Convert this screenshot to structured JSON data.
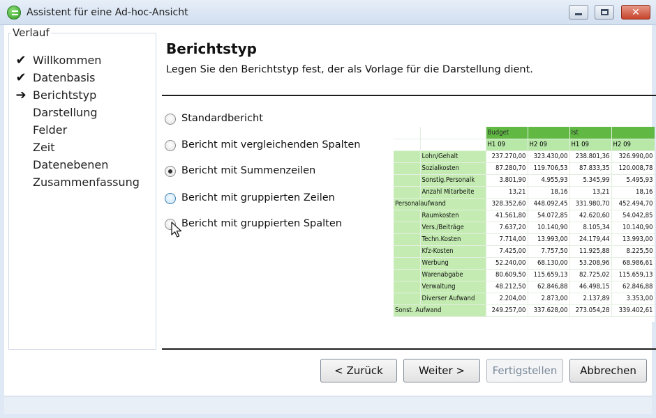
{
  "window": {
    "title": "Assistent für eine Ad-hoc-Ansicht",
    "icon": "app-icon"
  },
  "sidebar": {
    "caption": "Verlauf",
    "steps": [
      {
        "label": "Willkommen",
        "state": "done",
        "icon": "check-icon"
      },
      {
        "label": "Datenbasis",
        "state": "done",
        "icon": "check-icon"
      },
      {
        "label": "Berichtstyp",
        "state": "current",
        "icon": "arrow-right-icon"
      },
      {
        "label": "Darstellung",
        "state": "pending"
      },
      {
        "label": "Felder",
        "state": "pending"
      },
      {
        "label": "Zeit",
        "state": "pending"
      },
      {
        "label": "Datenebenen",
        "state": "pending"
      },
      {
        "label": "Zusammenfassung",
        "state": "pending"
      }
    ]
  },
  "main": {
    "title": "Berichtstyp",
    "description": "Legen Sie den Berichtstyp fest, der als Vorlage für die Darstellung dient.",
    "options": [
      {
        "label": "Standardbericht",
        "checked": false
      },
      {
        "label": "Bericht mit vergleichenden Spalten",
        "checked": false
      },
      {
        "label": "Bericht mit Summenzeilen",
        "checked": true
      },
      {
        "label": "Bericht mit gruppierten Zeilen",
        "checked": false
      },
      {
        "label": "Bericht mit gruppierten Spalten",
        "checked": false
      }
    ]
  },
  "preview": {
    "group_headers": [
      "Budget",
      "Ist"
    ],
    "sub_headers": [
      "H1 09",
      "H2 09",
      "H1 09",
      "H2 09"
    ],
    "rows": [
      {
        "label": "Lohn/Gehalt",
        "level": 2,
        "values": [
          "237.270,00",
          "323.430,00",
          "238.801,36",
          "326.990,00"
        ]
      },
      {
        "label": "Sozialkosten",
        "level": 2,
        "values": [
          "87.280,70",
          "119.706,53",
          "87.833,35",
          "120.008,78"
        ]
      },
      {
        "label": "Sonstig.Personalk",
        "level": 2,
        "values": [
          "3.801,90",
          "4.955,93",
          "5.345,99",
          "5.495,93"
        ]
      },
      {
        "label": "Anzahl Mitarbeite",
        "level": 2,
        "values": [
          "13,21",
          "18,16",
          "13,21",
          "18,16"
        ]
      },
      {
        "label": "Personalaufwand",
        "level": 1,
        "values": [
          "328.352,60",
          "448.092,45",
          "331.980,70",
          "452.494,70"
        ]
      },
      {
        "label": "Raumkosten",
        "level": 2,
        "values": [
          "41.561,80",
          "54.072,85",
          "42.620,60",
          "54.042,85"
        ]
      },
      {
        "label": "Vers./Beiträge",
        "level": 2,
        "values": [
          "7.637,20",
          "10.140,90",
          "8.105,34",
          "10.140,90"
        ]
      },
      {
        "label": "Techn.Kosten",
        "level": 2,
        "values": [
          "7.714,00",
          "13.993,00",
          "24.179,44",
          "13.993,00"
        ]
      },
      {
        "label": "Kfz-Kosten",
        "level": 2,
        "values": [
          "7.425,00",
          "7.757,50",
          "11.925,88",
          "8.225,50"
        ]
      },
      {
        "label": "Werbung",
        "level": 2,
        "values": [
          "52.240,00",
          "68.130,00",
          "53.208,96",
          "68.986,61"
        ]
      },
      {
        "label": "Warenabgabe",
        "level": 2,
        "values": [
          "80.609,50",
          "115.659,13",
          "82.725,02",
          "115.659,13"
        ]
      },
      {
        "label": "Verwaltung",
        "level": 2,
        "values": [
          "48.212,50",
          "62.846,88",
          "46.498,15",
          "62.846,88"
        ]
      },
      {
        "label": "Diverser Aufwand",
        "level": 2,
        "values": [
          "2.204,00",
          "2.873,00",
          "2.137,89",
          "3.353,00"
        ]
      },
      {
        "label": "Sonst. Aufwand",
        "level": 1,
        "values": [
          "249.257,00",
          "337.628,00",
          "273.054,28",
          "339.402,61"
        ]
      }
    ]
  },
  "buttons": {
    "back": "< Zurück",
    "next": "Weiter >",
    "finish": "Fertigstellen",
    "cancel": "Abbrechen"
  }
}
